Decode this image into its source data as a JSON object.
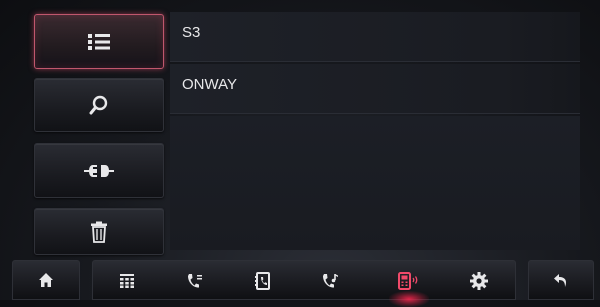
{
  "devices": [
    {
      "name": "S3"
    },
    {
      "name": "ONWAY"
    }
  ],
  "colors": {
    "accent": "#e6506e",
    "icon": "#e8e8ea",
    "active_icon": "#f04a6a"
  },
  "sidebar": {
    "buttons": [
      {
        "icon": "list-icon",
        "active": true
      },
      {
        "icon": "search-icon",
        "active": false
      },
      {
        "icon": "connect-icon",
        "active": false
      },
      {
        "icon": "trash-icon",
        "active": false
      }
    ]
  },
  "bottom_nav": {
    "items": [
      {
        "icon": "home-icon"
      },
      {
        "icon": "keypad-icon"
      },
      {
        "icon": "call-log-icon"
      },
      {
        "icon": "contacts-icon"
      },
      {
        "icon": "music-phone-icon"
      },
      {
        "icon": "bluetooth-phone-icon",
        "active": true
      },
      {
        "icon": "settings-icon"
      },
      {
        "icon": "back-icon"
      }
    ]
  }
}
